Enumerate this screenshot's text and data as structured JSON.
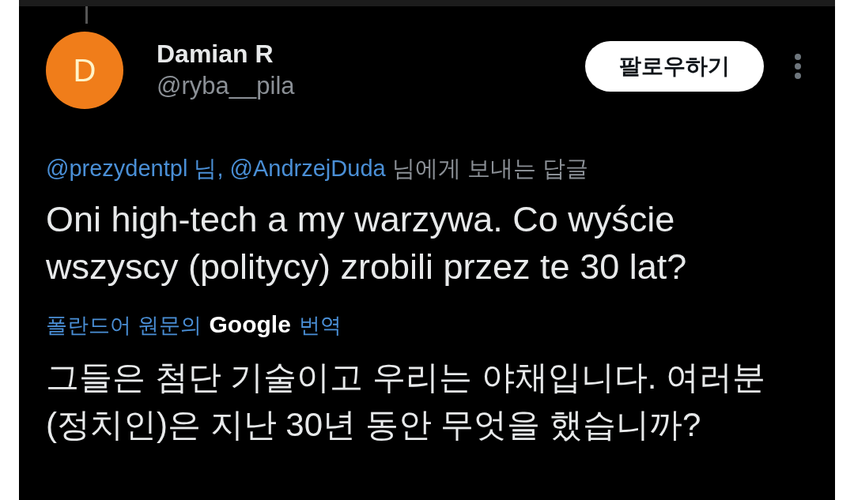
{
  "author": {
    "avatar_letter": "D",
    "name": "Damian R",
    "handle": "@ryba__pila"
  },
  "follow_button": "팔로우하기",
  "reply_context": {
    "mentions": "@prezydentpl 님, @AndrzejDuda",
    "rest": "님에게 보내는 답글"
  },
  "text": "Oni high-tech a my warzywa. Co wyście wszyscy (politycy) zrobili przez te 30 lat?",
  "translation_credit": {
    "before": "폴란드어 원문의",
    "brand": "Google",
    "after": "번역"
  },
  "translation": "그들은 첨단 기술이고 우리는 야채입니다. 여러분 (정치인)은 지난 30년 동안 무엇을 했습니까?"
}
